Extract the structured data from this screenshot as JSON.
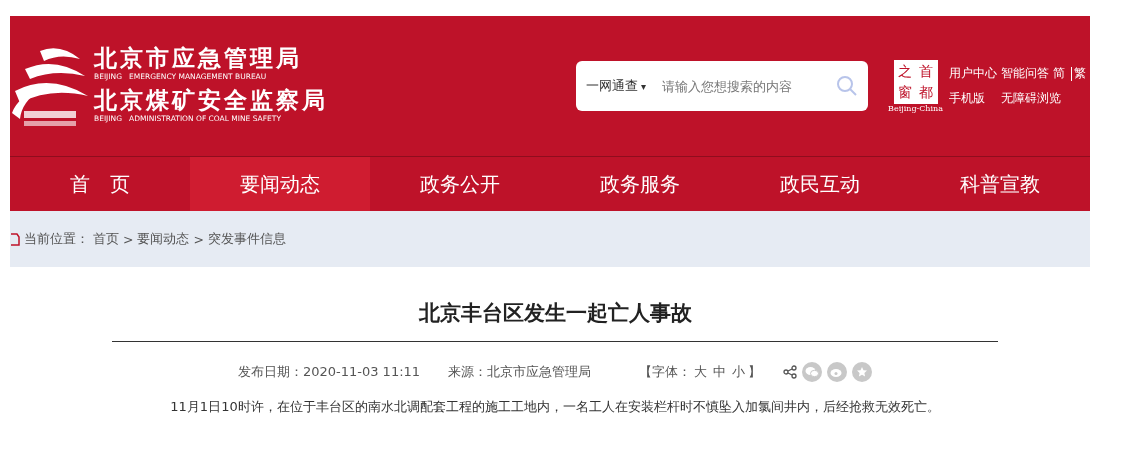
{
  "header": {
    "title_cn": "北京市应急管理局",
    "title_en": "BEIJING   EMERGENCY MANAGEMENT BUREAU",
    "subtitle_cn": "北京煤矿安全监察局",
    "subtitle_en": "BEIJING   ADMINISTRATION OF COAL MINE SAFETY",
    "logo_text": "Beijing-China",
    "logo_chars": [
      "之",
      "首",
      "窗",
      "都"
    ]
  },
  "search": {
    "scope": "一网通查",
    "scope_caret": "▾",
    "placeholder": "请输入您想搜索的内容"
  },
  "top_links": [
    {
      "label": "用户中心"
    },
    {
      "label": "智能问答"
    },
    {
      "label": "简"
    },
    {
      "label": "繁"
    },
    {
      "label": "手机版"
    },
    {
      "label": "无障碍浏览"
    }
  ],
  "nav": [
    {
      "label": "首　页",
      "selected": false
    },
    {
      "label": "要闻动态",
      "selected": true
    },
    {
      "label": "政务公开",
      "selected": false
    },
    {
      "label": "政务服务",
      "selected": false
    },
    {
      "label": "政民互动",
      "selected": false
    },
    {
      "label": "科普宣教",
      "selected": false
    }
  ],
  "breadcrumb": {
    "prefix": "当前位置：",
    "items": [
      "首页",
      "要闻动态",
      "突发事件信息"
    ],
    "separator": ">"
  },
  "article": {
    "title": "北京丰台区发生一起亡人事故",
    "date": "发布日期：2020-11-03 11:11",
    "source": "来源：北京市应急管理局",
    "font_label": "【字体：",
    "font_sizes": [
      "大",
      "中",
      "小"
    ],
    "font_end": "】",
    "body": "11月1日10时许，在位于丰台区的南水北调配套工程的施工工地内，一名工人在安装栏杆时不慎坠入加氯间井内，后经抢救无效死亡。"
  }
}
